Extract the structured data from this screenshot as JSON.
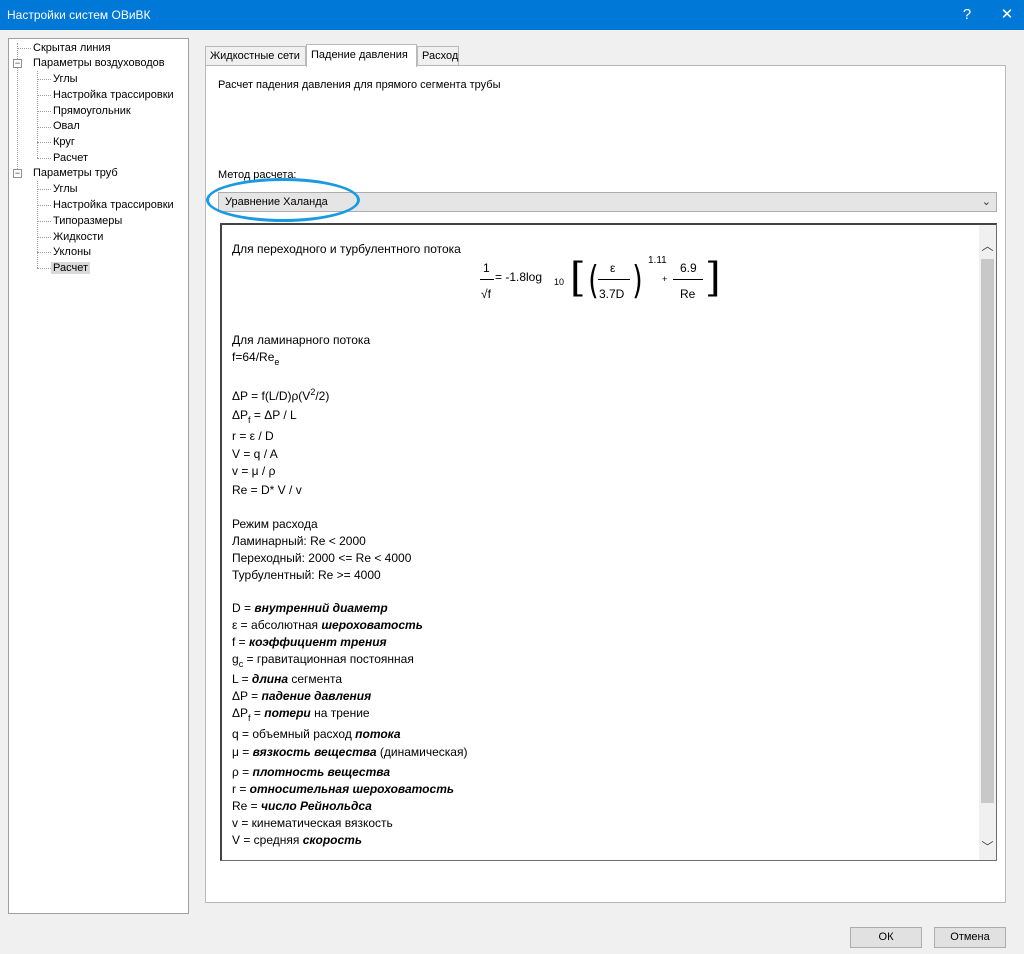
{
  "window": {
    "title": "Настройки систем ОВиВК",
    "help": "?",
    "close": "✕"
  },
  "tree": {
    "items": [
      {
        "label": "Скрытая линия"
      },
      {
        "label": "Параметры воздуховодов",
        "expander": "−"
      },
      {
        "label": "Углы"
      },
      {
        "label": "Настройка трассировки"
      },
      {
        "label": "Прямоугольник"
      },
      {
        "label": "Овал"
      },
      {
        "label": "Круг"
      },
      {
        "label": "Расчет"
      },
      {
        "label": "Параметры труб",
        "expander": "−"
      },
      {
        "label": "Углы"
      },
      {
        "label": "Настройка трассировки"
      },
      {
        "label": "Типоразмеры"
      },
      {
        "label": "Жидкости"
      },
      {
        "label": "Уклоны"
      },
      {
        "label": "Расчет"
      }
    ]
  },
  "tabs": [
    {
      "label": "Жидкостные сети"
    },
    {
      "label": "Падение давления"
    },
    {
      "label": "Расход"
    }
  ],
  "panel": {
    "description": "Расчет падения давления для прямого сегмента трубы",
    "method_label": "Метод расчета:",
    "method_value": "Уравнение Халанда",
    "combo_arrow": "⌄"
  },
  "formulas": {
    "turbulent_heading": "Для переходного и турбулентного потока",
    "main": {
      "one": "1",
      "sqrt_f": "√f",
      "equals": "= -1.8log",
      "log_base": "10",
      "eps": "ε",
      "d37": "3.7D",
      "exp": "1.11",
      "plus": "+",
      "num69": "6.9",
      "re": "Re",
      "lbracket": "[",
      "rbracket": "]",
      "lparen": "(",
      "rparen": ")"
    },
    "laminar_heading": "Для ламинарного потока",
    "laminar": {
      "base": "f=64/Re",
      "sub": "e"
    },
    "dp": {
      "a": "ΔP = f(L/D)ρ(V",
      "sup": "2",
      "b": "/2)"
    },
    "dpf": {
      "a": "ΔP",
      "sub": "f",
      "b": " = ΔP / L"
    },
    "r_eq": "r = ε / D",
    "v_eq": "V = q / A",
    "nu_eq": "v = μ / ρ",
    "re_eq": "Re = D* V / v",
    "regime_heading": "Режим расхода",
    "regimes": [
      "Ламинарный: Re < 2000",
      "Переходный: 2000 <= Re < 4000",
      "Турбулентный: Re >= 4000"
    ],
    "legend": {
      "d": {
        "a": "D = ",
        "b": "внутренний диаметр"
      },
      "eps": {
        "a": "ε = абсолютная ",
        "b": "шероховатость"
      },
      "f": {
        "a": "f = ",
        "b": "коэффициент трения"
      },
      "gc": {
        "a": "g",
        "sub": "c",
        "b": " = гравитационная постоянная"
      },
      "l": {
        "a": "L = ",
        "b": "длина",
        "c": " сегмента"
      },
      "dp": {
        "a": "ΔP = ",
        "b": "падение давления"
      },
      "dpf": {
        "a": "ΔP",
        "sub": "f",
        "b": " = ",
        "c": "потери",
        "d": " на трение"
      },
      "q": {
        "a": "q = объемный расход ",
        "b": "потока"
      },
      "mu": {
        "a": "μ = ",
        "b": "вязкость вещества",
        "c": " (динамическая)"
      },
      "rho": {
        "a": "ρ = ",
        "b": "плотность вещества"
      },
      "r": {
        "a": "r = ",
        "b": "относительная шероховатость"
      },
      "re": {
        "a": "Re = ",
        "b": "число Рейнольдса"
      },
      "nu": "v = кинематическая вязкость",
      "vel": {
        "a": "V = средняя ",
        "b": "скорость"
      }
    }
  },
  "scroll": {
    "up": "︿",
    "down": "﹀"
  },
  "buttons": {
    "ok": "ОК",
    "cancel": "Отмена"
  },
  "colors": {
    "titlebar": "#0078d7",
    "highlight": "#1a9ae0"
  }
}
